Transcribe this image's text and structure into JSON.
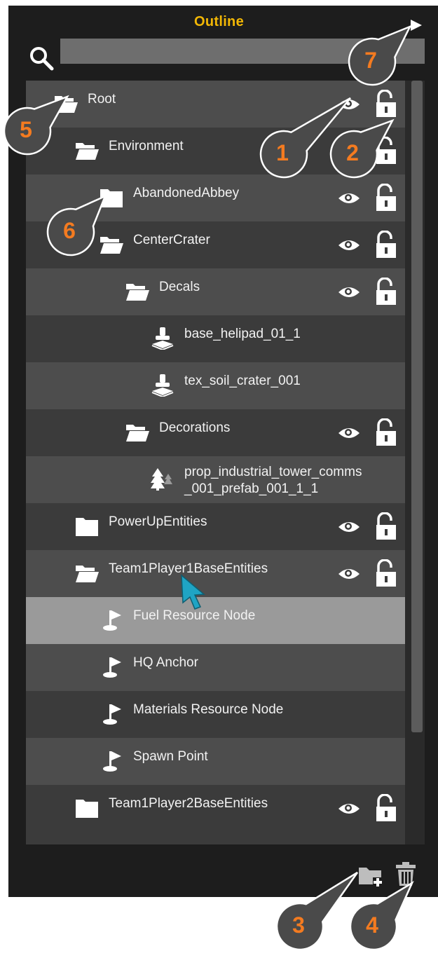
{
  "header": {
    "title": "Outline"
  },
  "search": {
    "value": "",
    "placeholder": ""
  },
  "tree": {
    "rows": [
      {
        "label": "Root",
        "icon": "folder-open-icon",
        "depth": 0,
        "has_toggles": true,
        "selected": false
      },
      {
        "label": "Environment",
        "icon": "folder-open-icon",
        "depth": 1,
        "has_toggles": true,
        "selected": false
      },
      {
        "label": "AbandonedAbbey",
        "icon": "folder-closed-icon",
        "depth": 2,
        "has_toggles": true,
        "selected": false
      },
      {
        "label": "CenterCrater",
        "icon": "folder-open-icon",
        "depth": 2,
        "has_toggles": true,
        "selected": false
      },
      {
        "label": "Decals",
        "icon": "folder-open-icon",
        "depth": 3,
        "has_toggles": true,
        "selected": false
      },
      {
        "label": "base_helipad_01_1",
        "icon": "decal-stamp-icon",
        "depth": 4,
        "has_toggles": false,
        "selected": false
      },
      {
        "label": "tex_soil_crater_001",
        "icon": "decal-stamp-icon",
        "depth": 4,
        "has_toggles": false,
        "selected": false
      },
      {
        "label": "Decorations",
        "icon": "folder-open-icon",
        "depth": 3,
        "has_toggles": true,
        "selected": false
      },
      {
        "label": "prop_industrial_tower_comms",
        "label2": "_001_prefab_001_1_1",
        "icon": "trees-icon",
        "depth": 4,
        "has_toggles": false,
        "selected": false
      },
      {
        "label": "PowerUpEntities",
        "icon": "folder-closed-icon",
        "depth": 1,
        "has_toggles": true,
        "selected": false
      },
      {
        "label": "Team1Player1BaseEntities",
        "icon": "folder-open-icon",
        "depth": 1,
        "has_toggles": true,
        "selected": false
      },
      {
        "label": "Fuel Resource Node",
        "icon": "flag-marker-icon",
        "depth": 2,
        "has_toggles": false,
        "selected": true
      },
      {
        "label": "HQ Anchor",
        "icon": "flag-marker-icon",
        "depth": 2,
        "has_toggles": false,
        "selected": false
      },
      {
        "label": "Materials Resource Node",
        "icon": "flag-marker-icon",
        "depth": 2,
        "has_toggles": false,
        "selected": false
      },
      {
        "label": "Spawn Point",
        "icon": "flag-marker-icon",
        "depth": 2,
        "has_toggles": false,
        "selected": false
      },
      {
        "label": "Team1Player2BaseEntities",
        "icon": "folder-closed-icon",
        "depth": 1,
        "has_toggles": true,
        "selected": false
      }
    ]
  },
  "footer": {
    "new_folder_icon": "new-folder-icon",
    "delete_icon": "trash-icon"
  },
  "callouts": [
    {
      "num": "1",
      "target": "visibility-toggle"
    },
    {
      "num": "2",
      "target": "lock-toggle"
    },
    {
      "num": "3",
      "target": "new-folder-button"
    },
    {
      "num": "4",
      "target": "delete-button"
    },
    {
      "num": "5",
      "target": "root-folder"
    },
    {
      "num": "6",
      "target": "folder-icon"
    },
    {
      "num": "7",
      "target": "expand-arrow"
    }
  ],
  "colors": {
    "title": "#f2b705",
    "callout_number": "#f47b20",
    "callout_fill": "#4a4a4a",
    "row_light": "#4d4d4d",
    "row_dark": "#3b3b3b",
    "row_selected": "#9a9a9a",
    "panel_bg": "#1d1d1d"
  }
}
